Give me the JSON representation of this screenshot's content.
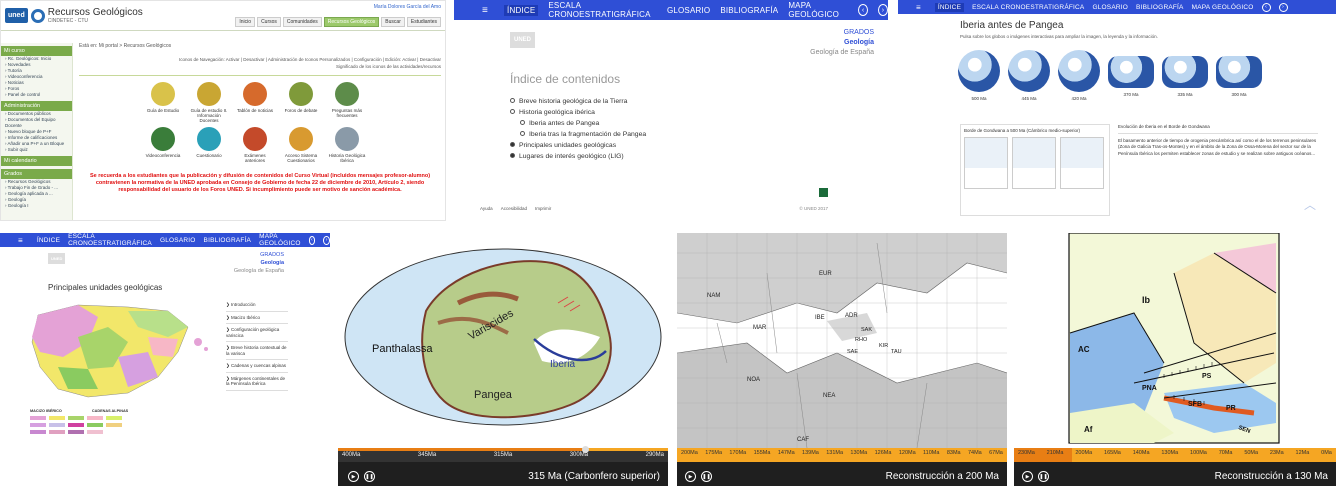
{
  "tile1": {
    "logo": "uned",
    "title": "Recursos Geológicos",
    "subtitle": "CINDETEC - CTU",
    "userbar": "María Dolores García del Amo",
    "toolbar": [
      "Inicio",
      "Cursos",
      "Comunidades",
      "Recursos Geológicos",
      "Buscar",
      "Estudiantes"
    ],
    "sidebar_head_1": "Mi curso",
    "sidebar_items_1": [
      "Rc. Geológicos: Inicio",
      "Novedades",
      "Tutoría",
      "Videoconferencia",
      "Noticias",
      "Foros",
      "Panel de control"
    ],
    "sidebar_head_2": "Administración",
    "sidebar_items_2": [
      "Documentos públicos",
      "Documentos del Equipo Docente",
      "Nuevo bloque de P+F",
      "Informe de calificaciones",
      "Añadir una P+F a un Bloque",
      "Subir quiz"
    ],
    "sidebar_head_3": "Mi calendario",
    "sidebar_head_4": "Grados",
    "sidebar_items_4": [
      "Recursos Geológicos",
      "Trabajo Fin de Grado - ...",
      "Geología aplicada a ...",
      "Geología",
      "Geología I"
    ],
    "crumb": "Está en: Mi portal > Recursos Geológicos",
    "bar_line": "Iconos de Navegación: Activar | Desactivar | Administración de Iconos Personalizados | Configuración | Edición: Activar | Desactivar",
    "bar_sub": "Significado de los iconos de las actividades/recursos",
    "icons": [
      {
        "label": "Guía de Estudio",
        "color": "#d9c24a"
      },
      {
        "label": "Guía de estudio II. Información Docentes",
        "color": "#c9a633"
      },
      {
        "label": "Tablón de noticias",
        "color": "#d66a2c"
      },
      {
        "label": "Foros de debate",
        "color": "#7f9a3a"
      },
      {
        "label": "Preguntas más frecuentes",
        "color": "#5d8c4a"
      },
      {
        "label": "Videoconferencia",
        "color": "#3a7d3a"
      },
      {
        "label": "Cuestionario",
        "color": "#2aa0b8"
      },
      {
        "label": "Exámenes anteriores",
        "color": "#c44a2a"
      },
      {
        "label": "Acceso Sistema Cuestionarios",
        "color": "#d89a30"
      },
      {
        "label": "Historia Geológica Ibérica",
        "color": "#8a9aa8"
      }
    ],
    "warning": "Se recuerda a los estudiantes que la publicación y difusión de contenidos del Curso Virtual (incluidos mensajes profesor-alumno) contravienen la normativa de la UNED aprobada en Consejo de Gobierno de fecha 22 de diciembre de 2010, Artículo 2, siendo responsabilidad del usuario de los Foros UNED. Si incumplimiento puede ser motivo de sanción académica."
  },
  "nav": {
    "items": [
      "ÍNDICE",
      "ESCALA CRONOESTRATIGRÁFICA",
      "GLOSARIO",
      "BIBLIOGRAFÍA",
      "MAPA GEOLÓGICO"
    ],
    "prev": "‹",
    "next": "›"
  },
  "tile2": {
    "brand": "UNED",
    "grados": "GRADOS",
    "geologia": "Geología",
    "subject": "Geología de España",
    "heading": "Índice de contenidos",
    "toc": [
      {
        "label": "Breve historia geológica de la Tierra",
        "level": 0,
        "filled": false
      },
      {
        "label": "Historia geológica ibérica",
        "level": 0,
        "filled": false
      },
      {
        "label": "Iberia antes de Pangea",
        "level": 1,
        "filled": false
      },
      {
        "label": "Iberia tras la fragmentación de Pangea",
        "level": 1,
        "filled": false
      },
      {
        "label": "Principales unidades geológicas",
        "level": 0,
        "filled": true
      },
      {
        "label": "Lugares de interés geológico (LIG)",
        "level": 0,
        "filled": true
      }
    ],
    "footer": [
      "Ayuda",
      "Accesibilidad",
      "Imprimir"
    ],
    "copyright": "© UNED 2017"
  },
  "tile3": {
    "heading": "Iberia antes de Pangea",
    "hint": "Pulsa sobre los globos o imágenes interactivas para ampliar la imagen, la leyenda y la información.",
    "globes": [
      "500 Ma",
      "445 Ma",
      "420 Ma",
      "370 Ma",
      "335 Ma",
      "300 Ma"
    ],
    "panel_title": "Borde de Gondwana a 500 Ma (Cámbrico medio-superior)",
    "text_head": "Evolución de Iberia en el Borde de Gondwana",
    "text_body": "El basamento anterior de tiempo de orogenia precámbrica así como el de los terrenos peninsulares (Zona de Galicia Tras-os-Montes) y en el ámbito de la Zona de Ossa-Morena del sector sur de la Península Ibérica los permiten establecer zonas de estudio y se realizan sobre antiguos océanos..."
  },
  "tile4": {
    "grados": "GRADOS",
    "geologia": "Geología",
    "subject": "Geología de España",
    "heading": "Principales unidades geológicas",
    "menu": [
      "Introducción",
      "Macizo Ibérico",
      "Configuración geológica variscica",
      "Breve historia contextual de la varisca",
      "Cadenas y cuencas alpinas",
      "Márgenes continentales de la Península Ibérica"
    ],
    "legend_head_1": "MACIZO IBÉRICO",
    "legend_head_2": "CADENAS ALPINAS"
  },
  "tile5": {
    "labels": [
      "Panthalassa",
      "Variscides",
      "Iberia",
      "Pangea"
    ],
    "ticks": [
      "400Ma",
      "345Ma",
      "315Ma",
      "300Ma",
      "290Ma"
    ],
    "caption": "315 Ma  (Carbonfero superior)",
    "progress": 0.74
  },
  "tile6": {
    "labels": [
      "EUR",
      "NAM",
      "IBE",
      "ADR",
      "MAR",
      "SAK",
      "RHO",
      "KIR",
      "SAE",
      "TAU",
      "NOA",
      "NEA",
      "CAF"
    ],
    "ticks": [
      "200Ma",
      "175Ma",
      "170Ma",
      "155Ma",
      "147Ma",
      "139Ma",
      "131Ma",
      "130Ma",
      "126Ma",
      "120Ma",
      "110Ma",
      "83Ma",
      "74Ma",
      "67Ma"
    ],
    "caption": "Reconstrucción a 200 Ma",
    "progress": 0.0
  },
  "tile7": {
    "labels": [
      "Ib",
      "AC",
      "PNA",
      "PS",
      "SFB",
      "PR",
      "Af",
      "SEN"
    ],
    "ticks": [
      "230Ma",
      "210Ma",
      "200Ma",
      "165Ma",
      "140Ma",
      "130Ma",
      "100Ma",
      "70Ma",
      "50Ma",
      "23Ma",
      "12Ma",
      "0Ma"
    ],
    "caption": "Reconstrucción a 130 Ma",
    "progress": 0.18
  }
}
